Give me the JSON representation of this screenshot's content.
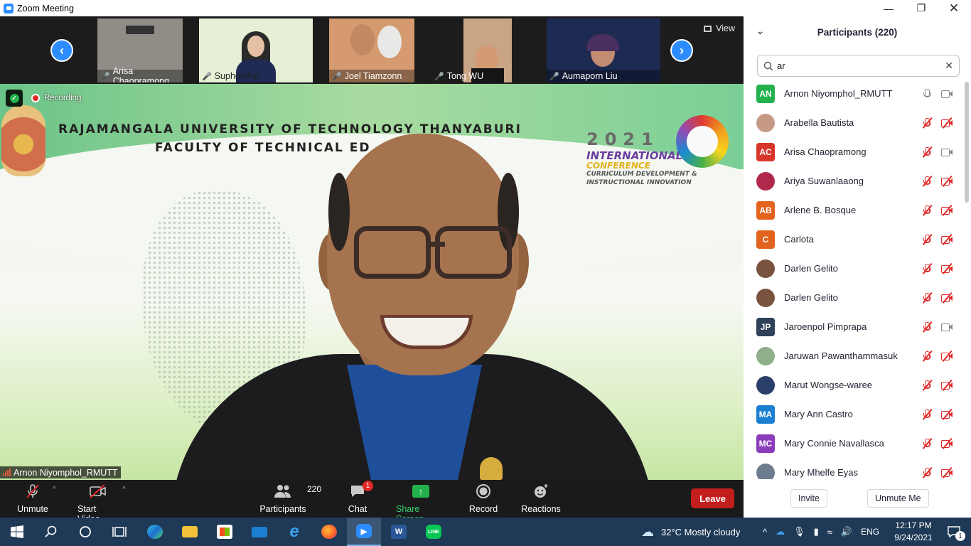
{
  "window": {
    "title": "Zoom Meeting"
  },
  "thumbnails": [
    {
      "name": "Arisa Chaopramong",
      "bg": "#8f8d86"
    },
    {
      "name": "Suphonthip",
      "bg": "#e7efd6"
    },
    {
      "name": "Joel Tiamzonn",
      "bg": "#d59a6f"
    },
    {
      "name": "Tong WU",
      "bg": "#c9a586"
    },
    {
      "name": "Aumaporn Liu",
      "bg": "#1d2a52"
    }
  ],
  "view_label": "View",
  "main": {
    "recording_label": "Recording",
    "banner_line1": "RAJAMANGALA UNIVERSITY OF TECHNOLOGY THANYABURI",
    "banner_line2": "FACULTY OF TECHNICAL ED",
    "conf_year": "2021",
    "conf_line1": "INTERNATIONAL",
    "conf_line2": "CONFERENCE",
    "conf_line3": "CURRICULUM DEVELOPMENT &",
    "conf_line4": "INSTRUCTIONAL INNOVATION",
    "speaker_name": "Arnon Niyomphol_RMUTT"
  },
  "toolbar": {
    "unmute": "Unmute",
    "start_video": "Start Video",
    "participants_count": "220",
    "participants": "Participants",
    "chat": "Chat",
    "chat_badge": "1",
    "share_screen": "Share Screen",
    "record": "Record",
    "reactions": "Reactions",
    "leave": "Leave"
  },
  "panel": {
    "title": "Participants (220)",
    "search_value": "ar",
    "invite": "Invite",
    "unmute_me": "Unmute Me",
    "participants": [
      {
        "initials": "AN",
        "name": "Arnon Niyomphol_RMUTT",
        "color": "#23b14d",
        "photo": false,
        "mic_muted": false,
        "video_off": false
      },
      {
        "initials": "",
        "name": "Arabella Bautista",
        "color": "#c79a86",
        "photo": true,
        "mic_muted": true,
        "video_off": true
      },
      {
        "initials": "AC",
        "name": "Arisa Chaopramong",
        "color": "#d9362b",
        "photo": false,
        "mic_muted": true,
        "video_off": false
      },
      {
        "initials": "",
        "name": "Ariya Suwanlaaong",
        "color": "#b0294d",
        "photo": true,
        "mic_muted": true,
        "video_off": true
      },
      {
        "initials": "AB",
        "name": "Arlene B. Bosque",
        "color": "#e2631d",
        "photo": false,
        "mic_muted": true,
        "video_off": true
      },
      {
        "initials": "C",
        "name": "Carlota",
        "color": "#e2631d",
        "photo": false,
        "mic_muted": true,
        "video_off": true
      },
      {
        "initials": "",
        "name": "Darlen Gelito",
        "color": "#7a5240",
        "photo": true,
        "mic_muted": true,
        "video_off": true
      },
      {
        "initials": "",
        "name": "Darlen Gelito",
        "color": "#7a5240",
        "photo": true,
        "mic_muted": true,
        "video_off": true
      },
      {
        "initials": "JP",
        "name": "Jaroenpol Pimprapa",
        "color": "#2f4159",
        "photo": false,
        "mic_muted": true,
        "video_off": false
      },
      {
        "initials": "",
        "name": "Jaruwan Pawanthammasuk",
        "color": "#8fae8a",
        "photo": true,
        "mic_muted": true,
        "video_off": true
      },
      {
        "initials": "",
        "name": "Marut Wongse-waree",
        "color": "#2b3f6b",
        "photo": true,
        "mic_muted": true,
        "video_off": true
      },
      {
        "initials": "MA",
        "name": "Mary Ann Castro",
        "color": "#1b7fd1",
        "photo": false,
        "mic_muted": true,
        "video_off": true
      },
      {
        "initials": "MC",
        "name": "Mary Connie Navallasca",
        "color": "#8a3cba",
        "photo": false,
        "mic_muted": true,
        "video_off": true
      },
      {
        "initials": "",
        "name": "Mary Mhelfe Eyas",
        "color": "#6e7c8f",
        "photo": true,
        "mic_muted": true,
        "video_off": true
      }
    ]
  },
  "taskbar": {
    "weather": "32°C  Mostly cloudy",
    "lang": "ENG",
    "time": "12:17 PM",
    "date": "9/24/2021",
    "notif_count": "1"
  }
}
